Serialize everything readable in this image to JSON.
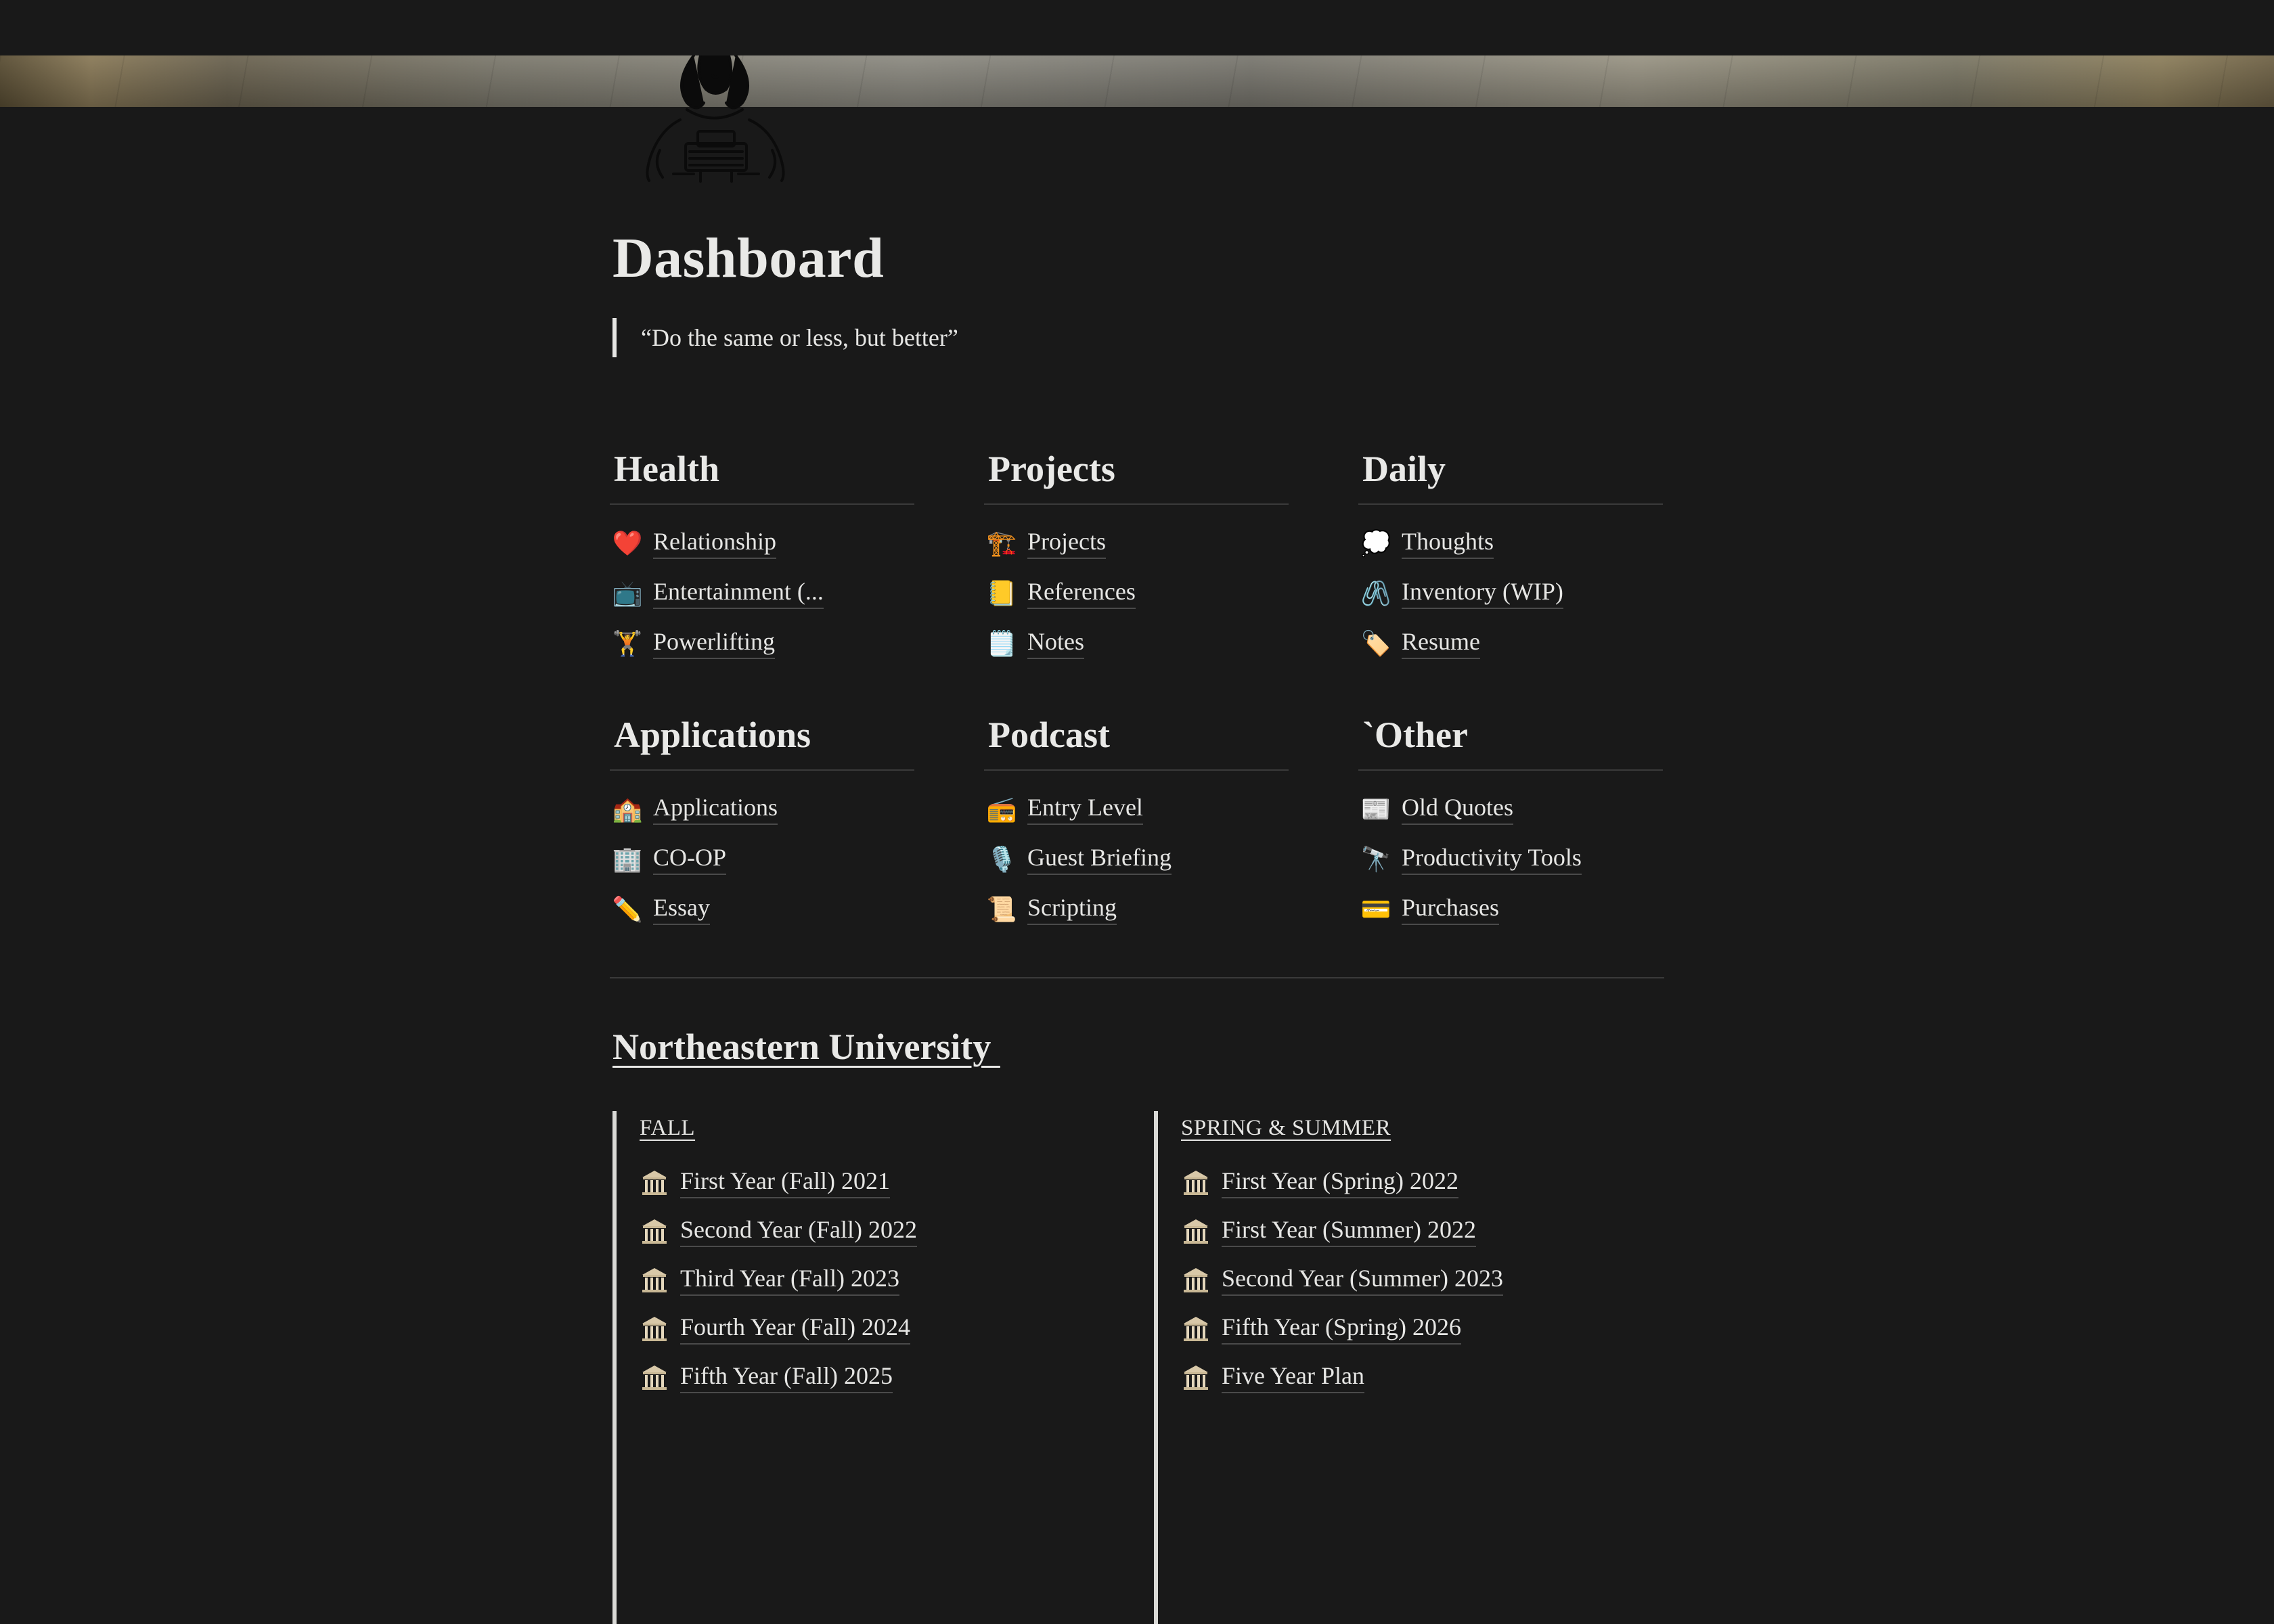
{
  "page": {
    "title": "Dashboard",
    "quote": "“Do the same or less, but better”"
  },
  "sections": [
    {
      "heading": "Health",
      "items": [
        {
          "icon": "heart",
          "glyph": "❤️",
          "label": "Relationship"
        },
        {
          "icon": "television",
          "glyph": "📺",
          "label": "Entertainment (..."
        },
        {
          "icon": "weightlifter",
          "glyph": "🏋️",
          "label": "Powerlifting"
        }
      ]
    },
    {
      "heading": "Projects",
      "items": [
        {
          "icon": "construction-crane",
          "glyph": "🏗️",
          "label": "Projects"
        },
        {
          "icon": "notepad",
          "glyph": "📒",
          "label": "References"
        },
        {
          "icon": "spiral-notepad",
          "glyph": "🗒️",
          "label": "Notes"
        }
      ]
    },
    {
      "heading": "Daily",
      "items": [
        {
          "icon": "thought-balloon",
          "glyph": "💭",
          "label": "Thoughts"
        },
        {
          "icon": "paperclips",
          "glyph": "🖇️",
          "label": "Inventory (WIP)"
        },
        {
          "icon": "label-tag",
          "glyph": "🏷️",
          "label": "Resume"
        }
      ]
    },
    {
      "heading": "Applications",
      "items": [
        {
          "icon": "school-building",
          "glyph": "🏫",
          "label": "Applications"
        },
        {
          "icon": "office-building",
          "glyph": "🏢",
          "label": "CO-OP"
        },
        {
          "icon": "pencil",
          "glyph": "✏️",
          "label": "Essay"
        }
      ]
    },
    {
      "heading": "Podcast",
      "items": [
        {
          "icon": "radio",
          "glyph": "📻",
          "label": "Entry Level"
        },
        {
          "icon": "microphone",
          "glyph": "🎙️",
          "label": "Guest Briefing"
        },
        {
          "icon": "scroll",
          "glyph": "📜",
          "label": "Scripting"
        }
      ]
    },
    {
      "heading": "`Other",
      "items": [
        {
          "icon": "newspaper",
          "glyph": "📰",
          "label": "Old Quotes"
        },
        {
          "icon": "telescope",
          "glyph": "🔭",
          "label": "Productivity Tools"
        },
        {
          "icon": "credit-card",
          "glyph": "💳",
          "label": "Purchases"
        }
      ]
    }
  ],
  "university": {
    "title": "Northeastern University ",
    "fall": {
      "heading": "FALL",
      "items": [
        "First Year (Fall) 2021",
        "Second Year (Fall) 2022",
        "Third Year (Fall) 2023",
        "Fourth Year (Fall) 2024",
        "Fifth Year (Fall) 2025"
      ]
    },
    "spring_summer": {
      "heading": "SPRING & SUMMER",
      "items": [
        "First Year (Spring) 2022",
        "First Year (Summer) 2022",
        "Second Year (Summer) 2023",
        "Fifth Year (Spring) 2026",
        "Five Year Plan"
      ]
    },
    "item_icon": "classical-building"
  },
  "colors": {
    "background": "#191919",
    "text": "#e6e6e4",
    "divider": "#3a3a3a"
  }
}
